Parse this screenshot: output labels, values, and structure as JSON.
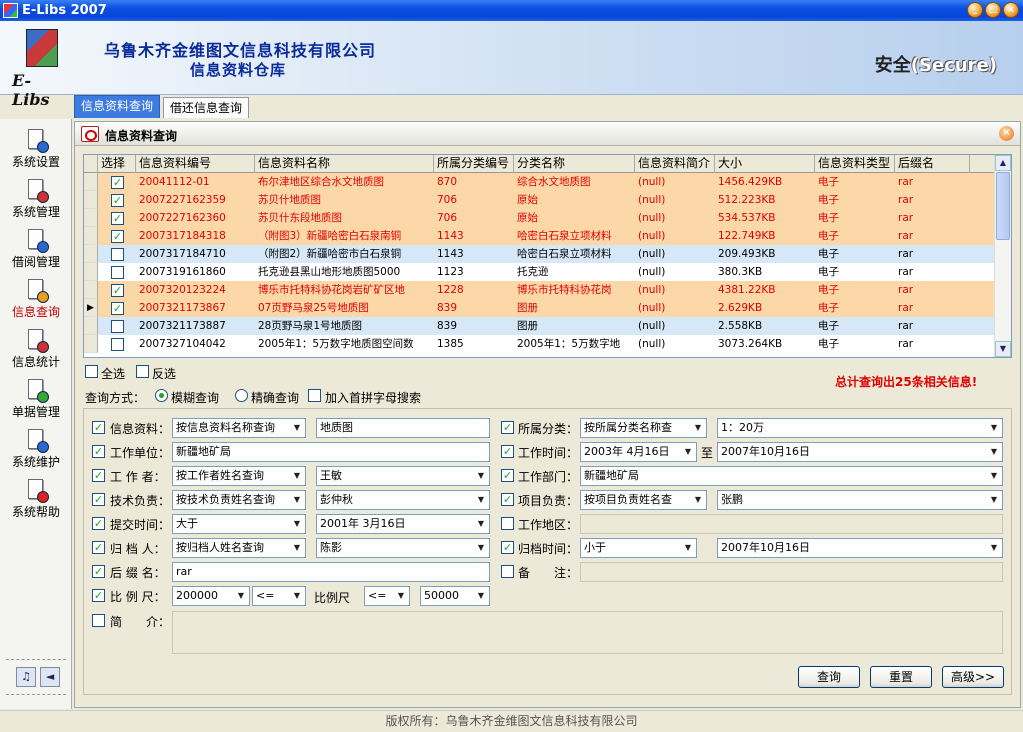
{
  "window": {
    "title": "E-Libs 2007"
  },
  "header": {
    "logo_text": "E-Libs",
    "company": "乌鲁木齐金维图文信息科技有限公司",
    "subtitle": "信息资料仓库",
    "secure_cn": "安全",
    "secure_en": "(Secure)"
  },
  "tabs": [
    {
      "label": "信息资料查询",
      "active": true
    },
    {
      "label": "借还信息查询",
      "active": false
    }
  ],
  "sidebar": {
    "items": [
      {
        "label": "系统设置",
        "icon": "settings-icon"
      },
      {
        "label": "系统管理",
        "icon": "user-admin-icon"
      },
      {
        "label": "借阅管理",
        "icon": "lending-icon"
      },
      {
        "label": "信息查询",
        "icon": "query-icon",
        "active": true
      },
      {
        "label": "信息统计",
        "icon": "statistics-icon"
      },
      {
        "label": "单据管理",
        "icon": "documents-icon"
      },
      {
        "label": "系统维护",
        "icon": "maintenance-icon"
      },
      {
        "label": "系统帮助",
        "icon": "help-icon"
      }
    ]
  },
  "panel": {
    "title": "信息资料查询"
  },
  "grid": {
    "columns": [
      "选择",
      "信息资料编号",
      "信息资料名称",
      "所属分类编号",
      "分类名称",
      "信息资料简介",
      "大小",
      "信息资料类型",
      "后缀名"
    ],
    "rows": [
      {
        "checked": true,
        "selected": true,
        "cells": [
          "20041112-01",
          "布尔津地区综合水文地质图",
          "870",
          "综合水文地质图",
          "(null)",
          "1456.429KB",
          "电子",
          "rar"
        ]
      },
      {
        "checked": true,
        "selected": true,
        "cells": [
          "2007227162359",
          "苏贝什地质图",
          "706",
          "原始",
          "(null)",
          "512.223KB",
          "电子",
          "rar"
        ]
      },
      {
        "checked": true,
        "selected": true,
        "cells": [
          "2007227162360",
          "苏贝什东段地质图",
          "706",
          "原始",
          "(null)",
          "534.537KB",
          "电子",
          "rar"
        ]
      },
      {
        "checked": true,
        "selected": true,
        "cells": [
          "2007317184318",
          "（附图3）新疆哈密白石泉南铜",
          "1143",
          "哈密白石泉立项材料",
          "(null)",
          "122.749KB",
          "电子",
          "rar"
        ]
      },
      {
        "checked": false,
        "selected": false,
        "alt": true,
        "cells": [
          "2007317184710",
          "（附图2）新疆哈密市白石泉铜",
          "1143",
          "哈密白石泉立项材料",
          "(null)",
          "209.493KB",
          "电子",
          "rar"
        ]
      },
      {
        "checked": false,
        "selected": false,
        "cells": [
          "2007319161860",
          "托克逊县黑山地形地质图5000",
          "1123",
          "托克逊",
          "(null)",
          "380.3KB",
          "电子",
          "rar"
        ]
      },
      {
        "checked": true,
        "selected": true,
        "cells": [
          "2007320123224",
          "博乐市托特科协花岗岩矿矿区地",
          "1228",
          "博乐市托特科协花岗",
          "(null)",
          "4381.22KB",
          "电子",
          "rar"
        ]
      },
      {
        "checked": true,
        "selected": true,
        "current": true,
        "cells": [
          "2007321173867",
          "07页野马泉25号地质图",
          "839",
          "图册",
          "(null)",
          "2.629KB",
          "电子",
          "rar"
        ]
      },
      {
        "checked": false,
        "selected": false,
        "alt": true,
        "cells": [
          "2007321173887",
          "28页野马泉1号地质图",
          "839",
          "图册",
          "(null)",
          "2.558KB",
          "电子",
          "rar"
        ]
      },
      {
        "checked": false,
        "selected": false,
        "cells": [
          "2007327104042",
          "2005年1：5万数字地质图空间数",
          "1385",
          "2005年1：5万数字地",
          "(null)",
          "3073.264KB",
          "电子",
          "rar"
        ]
      }
    ]
  },
  "select_all": "全选",
  "invert": "反选",
  "query_mode": {
    "label": "查询方式：",
    "fuzzy": "模糊查询",
    "exact": "精确查询",
    "pinyin": "加入首拼字母搜索"
  },
  "total_text": "总计查询出25条相关信息!",
  "form": {
    "info_label": "信息资料：",
    "info_mode": "按信息资料名称查询",
    "info_value": "地质图",
    "category_label": "所属分类：",
    "category_mode": "按所属分类名称查",
    "category_value": "1：20万",
    "unit_label": "工作单位：",
    "unit_value": "新疆地矿局",
    "worktime_label": "工作时间：",
    "worktime_from": "2003年 4月16日",
    "worktime_to_label": "至",
    "worktime_to": "2007年10月16日",
    "author_label": "工 作 者：",
    "author_mode": "按工作者姓名查询",
    "author_value": "王敏",
    "dept_label": "工作部门：",
    "dept_value": "新疆地矿局",
    "tech_label": "技术负责：",
    "tech_mode": "按技术负责姓名查询",
    "tech_value": "彭仲秋",
    "proj_label": "项目负责：",
    "proj_mode": "按项目负责姓名查",
    "proj_value": "张鹏",
    "submit_label": "提交时间：",
    "submit_op": "大于",
    "submit_date": "2001年 3月16日",
    "area_label": "工作地区：",
    "archiver_label": "归 档 人：",
    "archiver_mode": "按归档人姓名查询",
    "archiver_value": "陈影",
    "archive_time_label": "归档时间：",
    "archive_time_op": "小于",
    "archive_time_date": "2007年10月16日",
    "suffix_label": "后 缀 名：",
    "suffix_value": "rar",
    "remark_label": "备　　注：",
    "scale_label": "比 例 尺：",
    "scale_value": "200000",
    "scale_op1": "<=",
    "scale_mid": "比例尺",
    "scale_op2": "<=",
    "scale_value2": "50000",
    "brief_label": "简　　介："
  },
  "buttons": {
    "query": "查询",
    "reset": "重置",
    "advanced": "高级>>"
  },
  "status": "版权所有：乌鲁木齐金维图文信息科技有限公司",
  "colors": {
    "selected_row": "#fcd8a8",
    "selected_text": "#e00000",
    "alt_row": "#d6e8f8",
    "accent": "#3d7be0"
  }
}
